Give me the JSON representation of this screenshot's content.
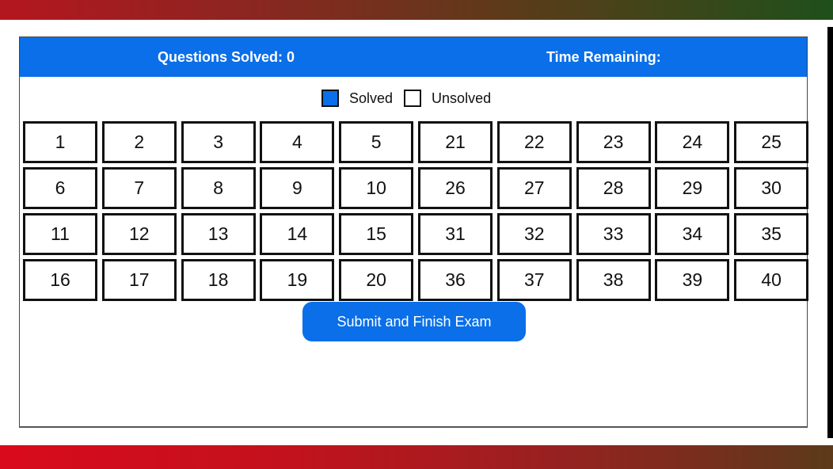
{
  "header": {
    "questions_solved_label": "Questions Solved: 0",
    "time_remaining_label": "Time Remaining:"
  },
  "legend": {
    "solved_label": "Solved",
    "unsolved_label": "Unsolved",
    "solved_color": "#0a6fe8",
    "unsolved_color": "#ffffff"
  },
  "questions": {
    "grid": [
      [
        "1",
        "2",
        "3",
        "4",
        "5",
        "21",
        "22",
        "23",
        "24",
        "25"
      ],
      [
        "6",
        "7",
        "8",
        "9",
        "10",
        "26",
        "27",
        "28",
        "29",
        "30"
      ],
      [
        "11",
        "12",
        "13",
        "14",
        "15",
        "31",
        "32",
        "33",
        "34",
        "35"
      ],
      [
        "16",
        "17",
        "18",
        "19",
        "20",
        "36",
        "37",
        "38",
        "39",
        "40"
      ]
    ],
    "solved": []
  },
  "submit_label": "Submit and Finish Exam",
  "colors": {
    "accent": "#0a6fe8",
    "top_bar_start": "#b4161f",
    "top_bar_end": "#1f4f1c",
    "bottom_bar_start": "#d90a1b",
    "bottom_bar_end": "#5b3a1a"
  }
}
